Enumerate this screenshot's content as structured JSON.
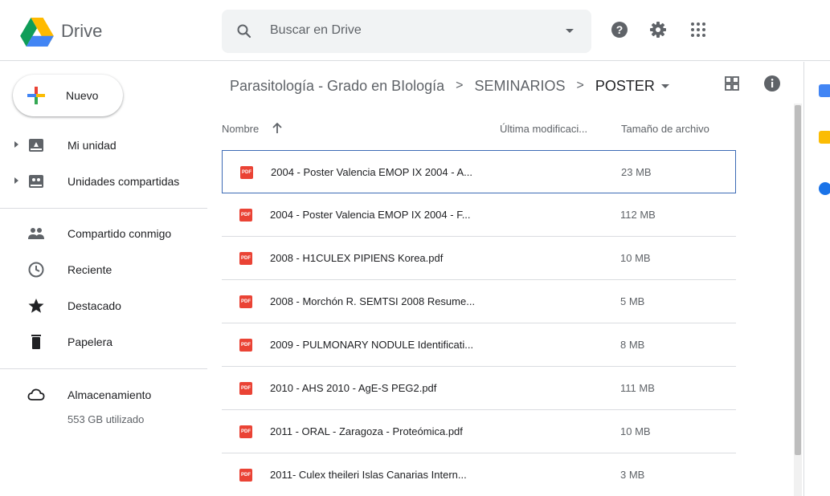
{
  "header": {
    "logo_text": "Drive",
    "search_placeholder": "Buscar en Drive"
  },
  "sidebar": {
    "new_label": "Nuevo",
    "items": [
      {
        "label": "Mi unidad"
      },
      {
        "label": "Unidades compartidas"
      },
      {
        "label": "Compartido conmigo"
      },
      {
        "label": "Reciente"
      },
      {
        "label": "Destacado"
      },
      {
        "label": "Papelera"
      },
      {
        "label": "Almacenamiento"
      }
    ],
    "storage_used": "553 GB utilizado"
  },
  "breadcrumb": {
    "items": [
      "Parasitología - Grado en BIología",
      "SEMINARIOS"
    ],
    "current": "POSTER"
  },
  "list": {
    "columns": {
      "name": "Nombre",
      "modified": "Última modificaci...",
      "size": "Tamaño de archivo"
    },
    "files": [
      {
        "icon_text": "PDF",
        "name": "2004 - Poster Valencia EMOP IX 2004 - A...",
        "size": "23 MB"
      },
      {
        "icon_text": "PDF",
        "name": "2004 - Poster Valencia EMOP IX 2004 - F...",
        "size": "112 MB"
      },
      {
        "icon_text": "PDF",
        "name": "2008 - H1CULEX PIPIENS Korea.pdf",
        "size": "10 MB"
      },
      {
        "icon_text": "PDF",
        "name": "2008 - Morchón R. SEMTSI 2008 Resume...",
        "size": "5 MB"
      },
      {
        "icon_text": "PDF",
        "name": "2009 - PULMONARY NODULE Identificati...",
        "size": "8 MB"
      },
      {
        "icon_text": "PDF",
        "name": "2010 - AHS 2010 - AgE-S PEG2.pdf",
        "size": "111 MB"
      },
      {
        "icon_text": "PDF",
        "name": "2011 - ORAL - Zaragoza - Proteómica.pdf",
        "size": "10 MB"
      },
      {
        "icon_text": "PDF",
        "name": "2011- Culex theileri Islas Canarias Intern...",
        "size": "3 MB"
      }
    ]
  },
  "colors": {
    "selected_border": "#3c6ab5",
    "pdf_red": "#ea4335",
    "text_primary": "#202124",
    "text_secondary": "#5f6368"
  }
}
